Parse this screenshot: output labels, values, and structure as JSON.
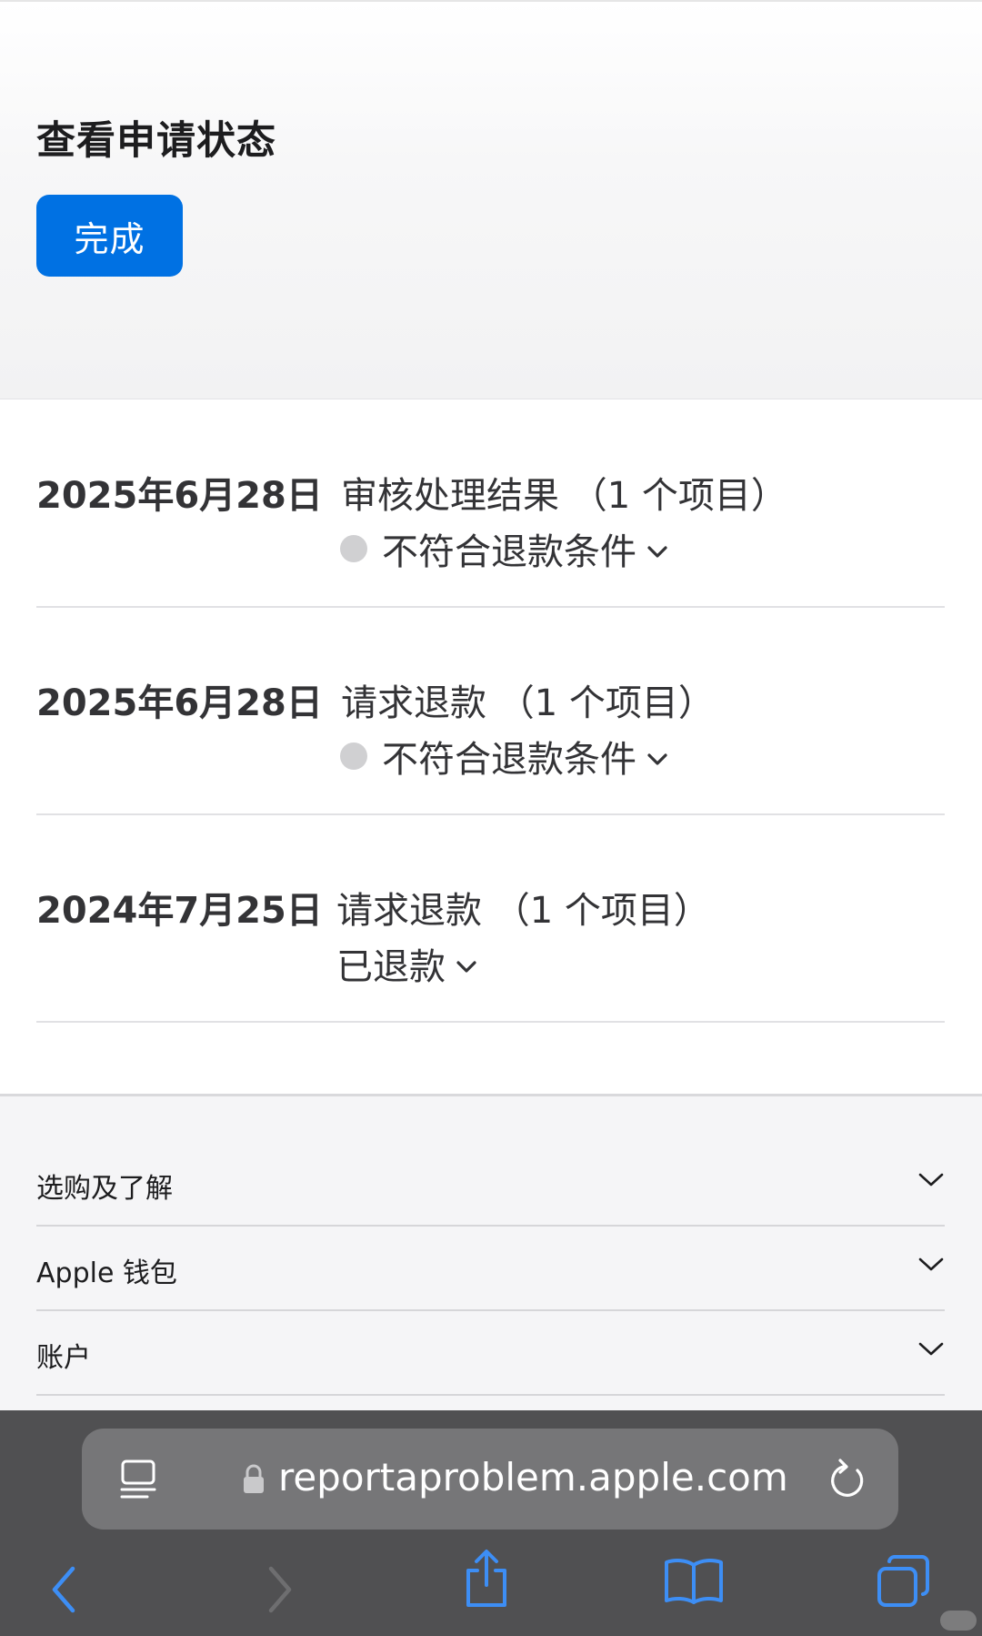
{
  "header": {
    "title": "查看申请状态",
    "done_label": "完成"
  },
  "requests": [
    {
      "date": "2025年6月28日",
      "type": "审核处理结果 （1 个项目）",
      "status": "不符合退款条件",
      "status_dot": true
    },
    {
      "date": "2025年6月28日",
      "type": "请求退款 （1 个项目）",
      "status": "不符合退款条件",
      "status_dot": true
    },
    {
      "date": "2024年7月25日",
      "type": "请求退款 （1 个项目）",
      "status": "已退款",
      "status_dot": false
    }
  ],
  "footer": {
    "items": [
      {
        "label": "选购及了解"
      },
      {
        "label": "Apple 钱包"
      },
      {
        "label": "账户"
      }
    ]
  },
  "browser": {
    "url": "reportaproblem.apple.com"
  },
  "colors": {
    "accent": "#0071e3",
    "toolbar_active": "#3d8ef5",
    "toolbar_disabled": "#6e6e70",
    "status_dot": "#d0d0d2"
  },
  "icons": {
    "status_chevron": "chevron-down-icon",
    "footer_chevron": "chevron-down-icon",
    "url_left": "reader-icon",
    "url_lock": "lock-icon",
    "url_right": "reload-icon",
    "toolbar": [
      "back-icon",
      "forward-icon",
      "share-icon",
      "bookmarks-icon",
      "tabs-icon"
    ]
  }
}
